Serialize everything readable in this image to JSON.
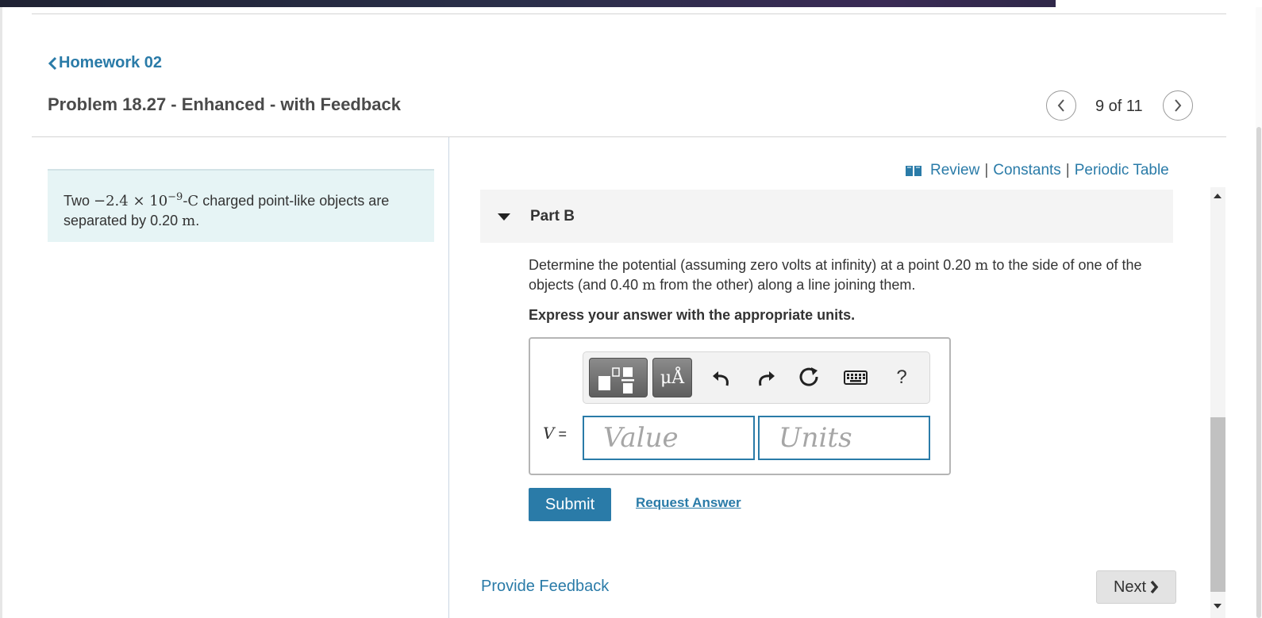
{
  "nav": {
    "back_label": "Homework 02",
    "problem_title": "Problem 18.27 - Enhanced - with Feedback",
    "counter": "9 of 11"
  },
  "problem": {
    "text_before": "Two ",
    "charge_math": "−2.4 × 10",
    "charge_exp": "−9",
    "charge_unit": "-C",
    "text_mid": " charged point-like objects are separated by 0.20 ",
    "unit_m": "m",
    "text_end": "."
  },
  "resources": {
    "review": "Review",
    "separator": "|",
    "constants": "Constants",
    "periodic_table": "Periodic Table"
  },
  "part": {
    "label": "Part B",
    "q_1": "Determine the potential (assuming zero volts at infinity) at a point 0.20 ",
    "q_m1": "m",
    "q_2": " to the side of one of the objects (and 0.40 ",
    "q_m2": "m",
    "q_3": " from the other) along a line joining them.",
    "instruction": "Express your answer with the appropriate units."
  },
  "answer": {
    "units_button": "μÅ",
    "help_label": "?",
    "variable": "V",
    "equals": " =",
    "value_placeholder": "Value",
    "units_placeholder": "Units"
  },
  "actions": {
    "submit": "Submit",
    "request_answer": "Request Answer",
    "provide_feedback": "Provide Feedback",
    "next": "Next"
  },
  "colors": {
    "link": "#2a7ba8",
    "problem_bg": "#e6f4f5",
    "part_header_bg": "#f4f4f4",
    "submit_bg": "#2a7ba8"
  }
}
